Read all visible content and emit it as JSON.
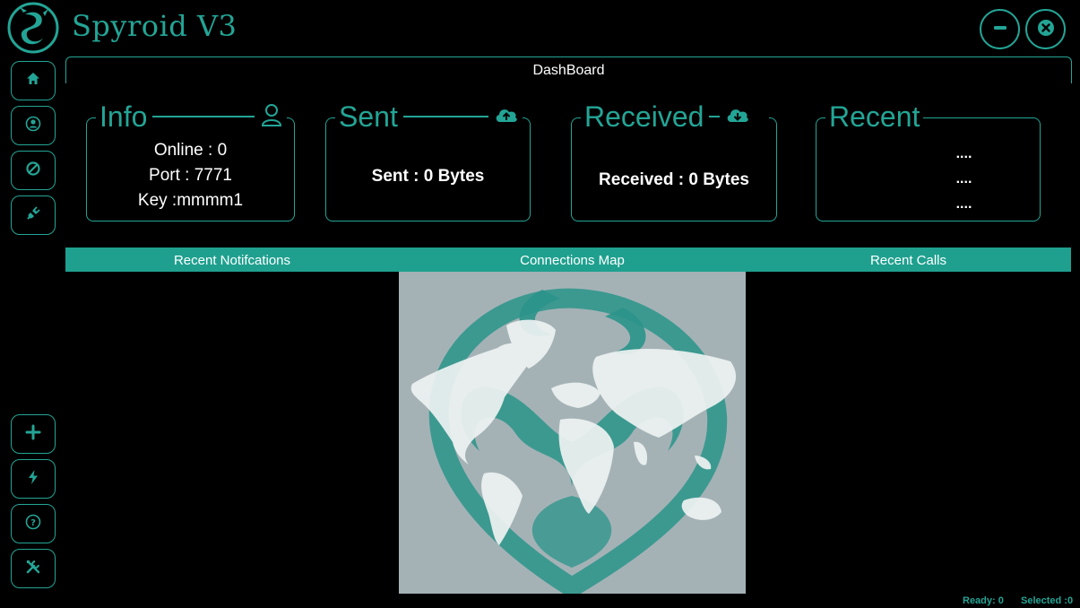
{
  "app": {
    "title": "Spyroid V3",
    "accent_color": "#23a596",
    "background_color": "#000000"
  },
  "window_controls": {
    "minimize_icon": "minus-icon",
    "close_icon": "close-circle-icon"
  },
  "sidebar": {
    "top_items": [
      {
        "icon": "home-icon"
      },
      {
        "icon": "user-icon"
      },
      {
        "icon": "block-icon"
      },
      {
        "icon": "plug-icon"
      }
    ],
    "bottom_items": [
      {
        "icon": "plus-icon"
      },
      {
        "icon": "lightning-icon"
      },
      {
        "icon": "help-icon"
      },
      {
        "icon": "tools-icon"
      }
    ]
  },
  "dashboard": {
    "title": "DashBoard"
  },
  "cards": {
    "info": {
      "title": "Info",
      "icon": "user-outline-icon",
      "online": "Online : 0",
      "port": "Port : 7771",
      "key": "Key :mmmm1"
    },
    "sent": {
      "title": "Sent",
      "icon": "cloud-upload-icon",
      "value": "Sent : 0 Bytes"
    },
    "received": {
      "title": "Received",
      "icon": "cloud-download-icon",
      "value": "Received : 0 Bytes"
    },
    "recent": {
      "title": "Recent",
      "items": [
        "....",
        "....",
        "...."
      ]
    }
  },
  "tabs": [
    {
      "label": "Recent Notifcations"
    },
    {
      "label": "Connections Map"
    },
    {
      "label": "Recent Calls"
    }
  ],
  "status": {
    "ready": "Ready: 0",
    "selected": "Selected :0"
  }
}
